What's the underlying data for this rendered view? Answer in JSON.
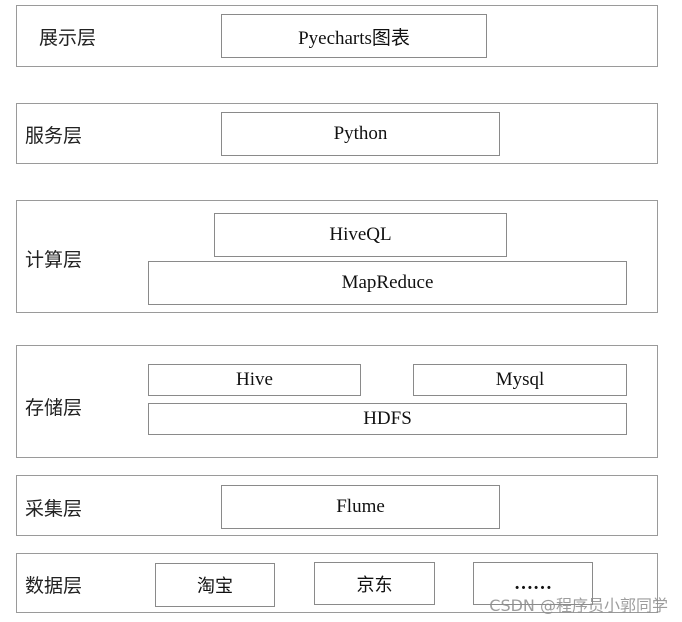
{
  "diagram": {
    "layers": [
      {
        "label": "展示层",
        "components": [
          "Pyecharts图表"
        ]
      },
      {
        "label": "服务层",
        "components": [
          "Python"
        ]
      },
      {
        "label": "计算层",
        "components": [
          "HiveQL",
          "MapReduce"
        ]
      },
      {
        "label": "存储层",
        "components": [
          "Hive",
          "Mysql",
          "HDFS"
        ]
      },
      {
        "label": "采集层",
        "components": [
          "Flume"
        ]
      },
      {
        "label": "数据层",
        "components": [
          "淘宝",
          "京东",
          "……"
        ]
      }
    ],
    "watermark": "CSDN @程序员小郭同学"
  }
}
